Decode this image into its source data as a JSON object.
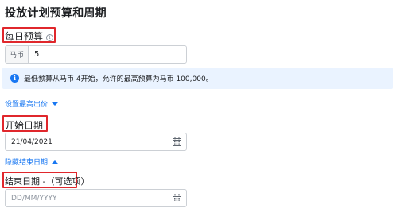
{
  "page": {
    "title": "投放计划预算和周期"
  },
  "daily_budget": {
    "label": "每日预算",
    "info_icon": "info-icon",
    "currency_prefix": "马币",
    "value": "5"
  },
  "notice": {
    "icon": "info-icon",
    "text": "最低预算从马币 4开始，允许的最高预算为马币 100,000。"
  },
  "bid_link": {
    "label": "设置最高出价",
    "icon": "chevron-down-icon"
  },
  "start_date": {
    "label": "开始日期",
    "value": "21/04/2021",
    "icon": "calendar-icon"
  },
  "hide_end_link": {
    "label": "隐藏结束日期",
    "icon": "chevron-up-icon"
  },
  "end_date": {
    "label": "结束日期 -（可选项）",
    "placeholder": "DD/MM/YYYY",
    "icon": "calendar-icon"
  },
  "colors": {
    "accent": "#1877f2",
    "highlight_box": "#e0272c",
    "notice_bg": "#eaf3ff"
  }
}
